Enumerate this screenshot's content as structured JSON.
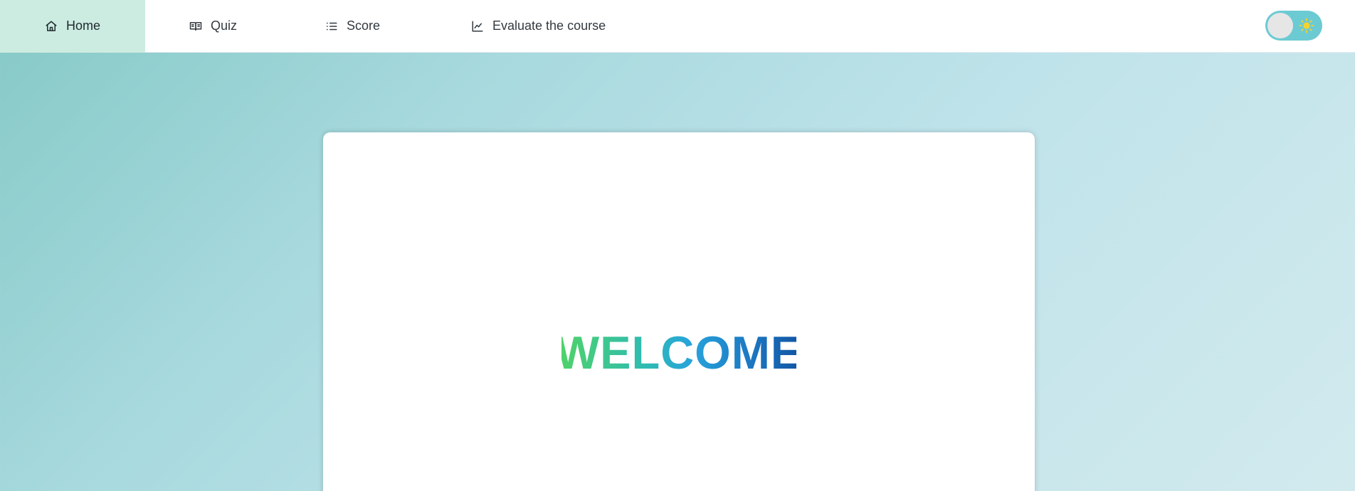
{
  "nav": {
    "items": [
      {
        "label": "Home",
        "icon": "home-icon",
        "active": true
      },
      {
        "label": "Quiz",
        "icon": "book-icon",
        "active": false
      },
      {
        "label": "Score",
        "icon": "list-icon",
        "active": false
      },
      {
        "label": "Evaluate the course",
        "icon": "chart-line-icon",
        "active": false
      }
    ],
    "theme_toggle": {
      "state": "light",
      "icon": "sun-icon"
    }
  },
  "main": {
    "welcome_text": "WELCOME"
  },
  "colors": {
    "active_nav_bg": "#cdece1",
    "toggle_bg": "#6ccad3",
    "sun": "#f6d32d",
    "welcome_gradient": [
      "#4fd26a",
      "#27a4dc",
      "#1258a6"
    ]
  }
}
